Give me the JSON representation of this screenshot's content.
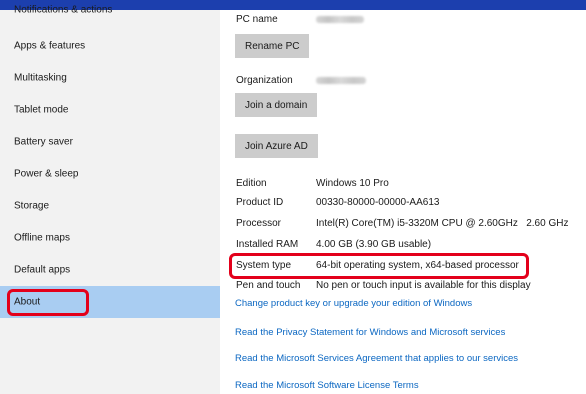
{
  "sidebar": {
    "items": [
      {
        "label": "Notifications & actions"
      },
      {
        "label": "Apps & features"
      },
      {
        "label": "Multitasking"
      },
      {
        "label": "Tablet mode"
      },
      {
        "label": "Battery saver"
      },
      {
        "label": "Power & sleep"
      },
      {
        "label": "Storage"
      },
      {
        "label": "Offline maps"
      },
      {
        "label": "Default apps"
      },
      {
        "label": "About",
        "selected": true
      }
    ]
  },
  "main": {
    "pc_name_label": "PC name",
    "rename_button": "Rename PC",
    "organization_label": "Organization",
    "join_domain_button": "Join a domain",
    "join_azure_button": "Join Azure AD",
    "specs": [
      {
        "label": "Edition",
        "value": "Windows 10 Pro"
      },
      {
        "label": "Product ID",
        "value": "00330-80000-00000-AA613"
      },
      {
        "label": "Processor",
        "value": "Intel(R) Core(TM) i5-3320M CPU @ 2.60GHz   2.60 GHz"
      },
      {
        "label": "Installed RAM",
        "value": "4.00 GB (3.90 GB usable)"
      },
      {
        "label": "System type",
        "value": "64-bit operating system, x64-based processor"
      },
      {
        "label": "Pen and touch",
        "value": "No pen or touch input is available for this display"
      }
    ],
    "links": [
      "Change product key or upgrade your edition of Windows",
      "Read the Privacy Statement for Windows and Microsoft services",
      "Read the Microsoft Services Agreement that applies to our services",
      "Read the Microsoft Software License Terms"
    ]
  },
  "colors": {
    "accent_bar": "#1c3fae",
    "selected_item": "#a9cdf2",
    "highlight": "#e3001b",
    "link": "#0b67c2"
  }
}
